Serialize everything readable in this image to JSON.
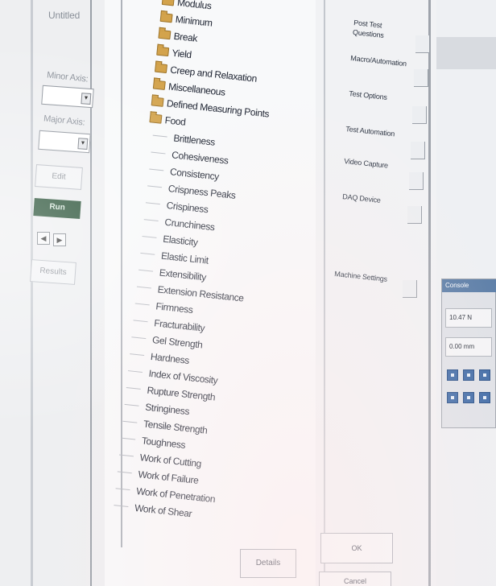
{
  "left_panel": {
    "title": "Untitled",
    "minor_axis_label": "Minor Axis:",
    "major_axis_label": "Major Axis:",
    "edit_button": "Edit",
    "run_button": "Run",
    "prev_icon": "triangle-left",
    "next_icon": "triangle-right",
    "results_button": "Results"
  },
  "tree": {
    "folders": [
      "Modulus",
      "Minimum",
      "Break",
      "Yield",
      "Creep and Relaxation",
      "Miscellaneous",
      "Defined Measuring Points",
      "Food"
    ],
    "food_children": [
      "Brittleness",
      "Cohesiveness",
      "Consistency",
      "Crispness Peaks",
      "Crispiness",
      "Crunchiness",
      "Elasticity",
      "Elastic Limit",
      "Extensibility",
      "Extension Resistance",
      "Firmness",
      "Fracturability",
      "Gel Strength",
      "Hardness",
      "Index of Viscosity",
      "Rupture Strength",
      "Stringiness",
      "Tensile Strength",
      "Toughness",
      "Work of Cutting",
      "Work of Failure",
      "Work of Penetration",
      "Work of Shear"
    ],
    "details_button": "Details"
  },
  "right_panel": {
    "items": [
      "Post Test Questions",
      "Macro/Automation",
      "Test Options",
      "Test Automation",
      "Video Capture",
      "DAQ Device"
    ],
    "machine_settings": "Machine Settings",
    "ok_button": "OK",
    "cancel_button": "Cancel"
  },
  "status_window": {
    "title": "Console",
    "force_value": "10.47 N",
    "position_value": "0.00 mm"
  },
  "colors": {
    "run_button_bg": "#1f4a2e",
    "folder_icon": "#d3a34c",
    "status_title_bg": "#5d7fa8"
  }
}
